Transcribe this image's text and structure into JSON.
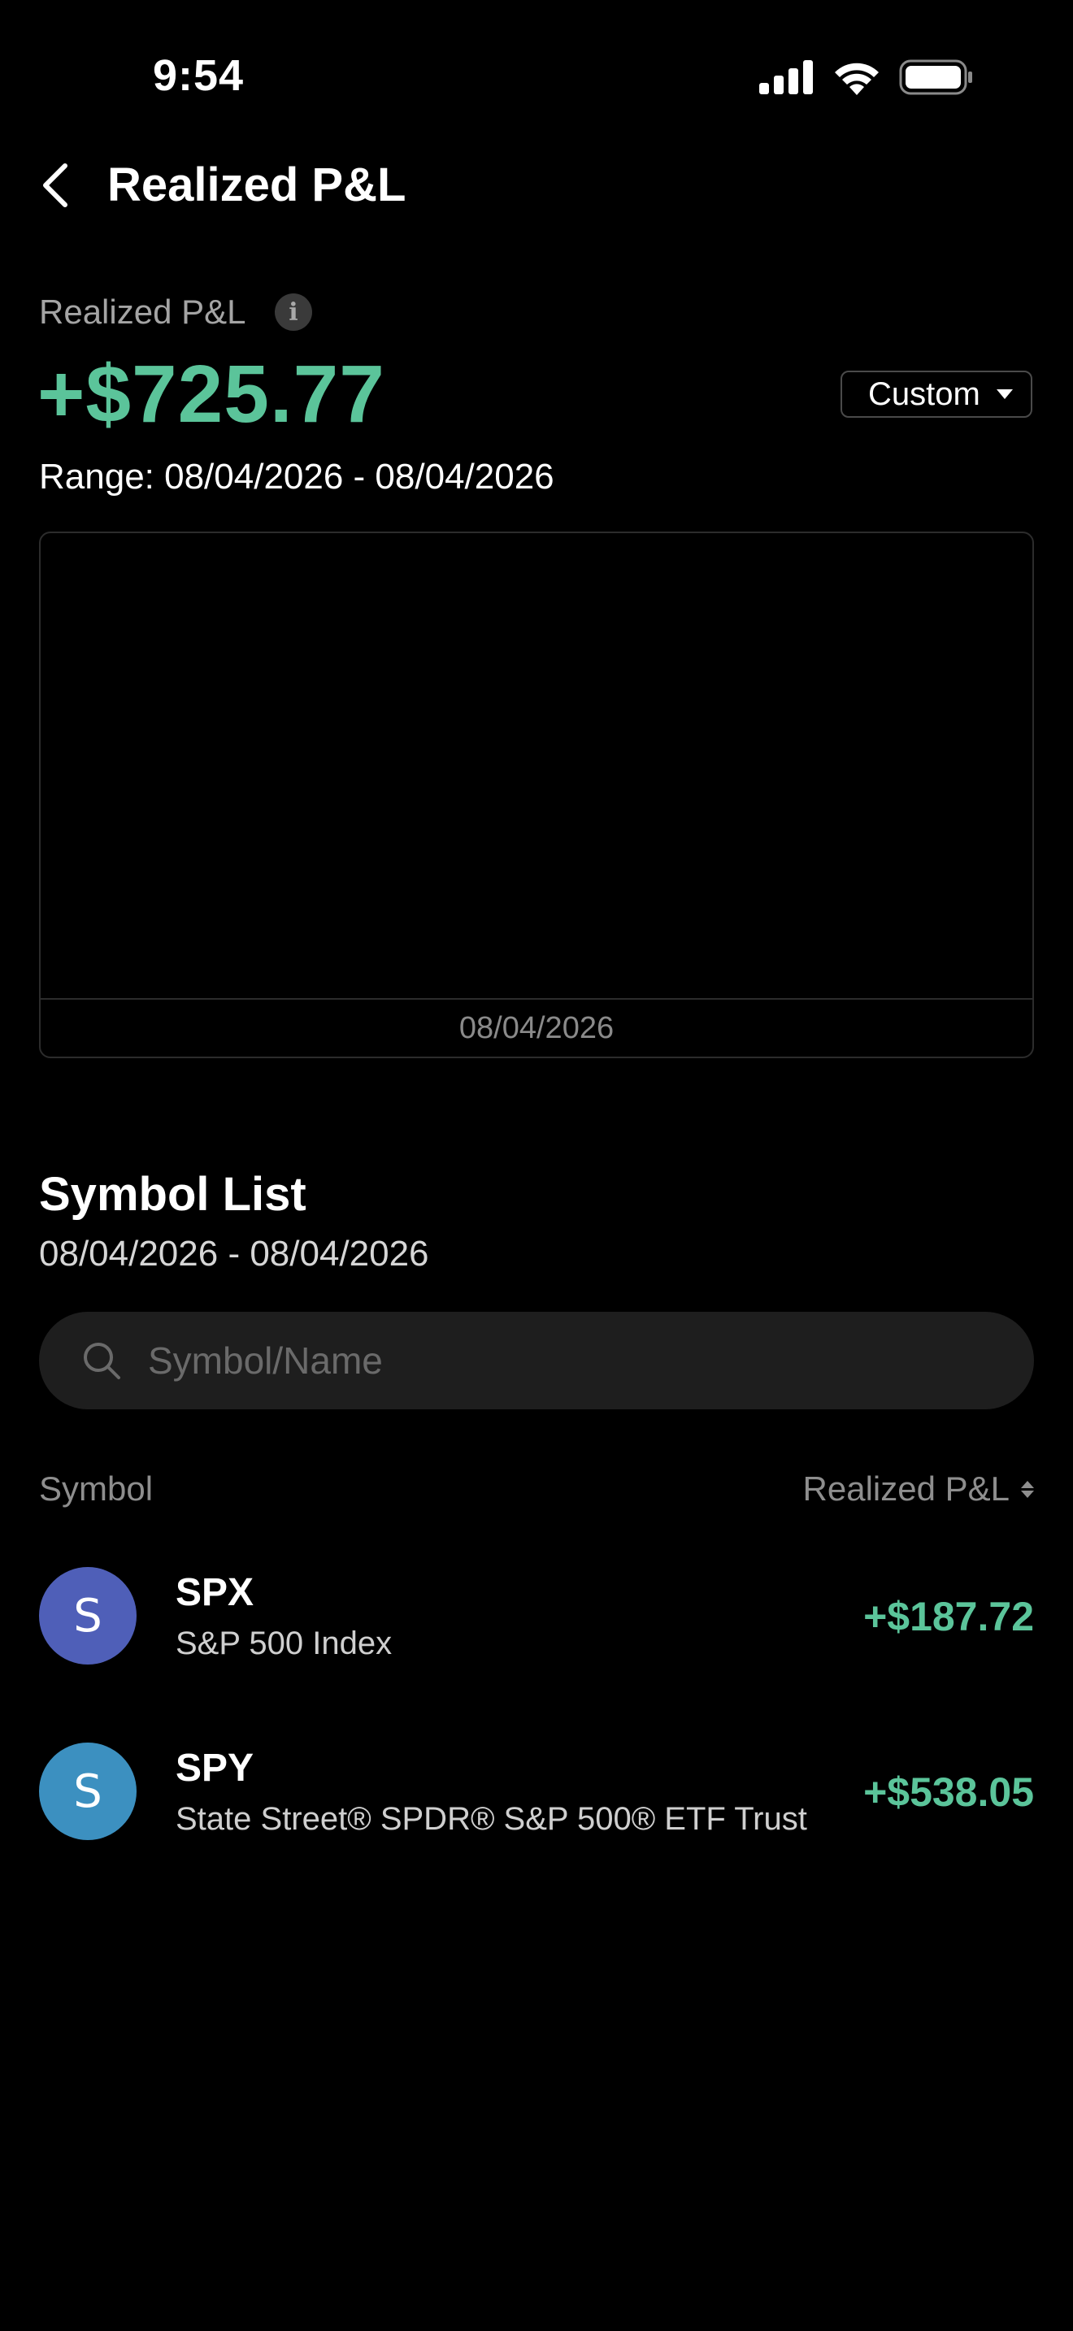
{
  "status_bar": {
    "time": "9:54"
  },
  "header": {
    "title": "Realized P&L"
  },
  "summary": {
    "label": "Realized P&L",
    "info_glyph": "i",
    "value": "+$725.77",
    "range": "Range: 08/04/2026 - 08/04/2026",
    "period_select": "Custom"
  },
  "chart": {
    "x_label": "08/04/2026"
  },
  "symbol_list": {
    "title": "Symbol List",
    "range": "08/04/2026 - 08/04/2026",
    "search_placeholder": "Symbol/Name",
    "columns": {
      "symbol": "Symbol",
      "pnl": "Realized P&L"
    },
    "rows": [
      {
        "avatar_letter": "S",
        "avatar_color": "#4f5fb8",
        "symbol": "SPX",
        "name": "S&P 500 Index",
        "pnl": "+$187.72"
      },
      {
        "avatar_letter": "S",
        "avatar_color": "#3c90c0",
        "symbol": "SPY",
        "name": "State Street® SPDR® S&P 500® ETF Trust",
        "pnl": "+$538.05"
      }
    ]
  },
  "colors": {
    "background": "#000000",
    "positive": "#5bc49a",
    "muted_text": "#8e8e8e",
    "search_bg": "#1e1e1e"
  },
  "icons": {
    "back": "chevron-left-icon",
    "info": "info-icon",
    "dropdown": "caret-down-icon",
    "search": "search-icon",
    "sort": "sort-icon",
    "signal": "cellular-signal-icon",
    "wifi": "wifi-icon",
    "battery": "battery-icon"
  }
}
